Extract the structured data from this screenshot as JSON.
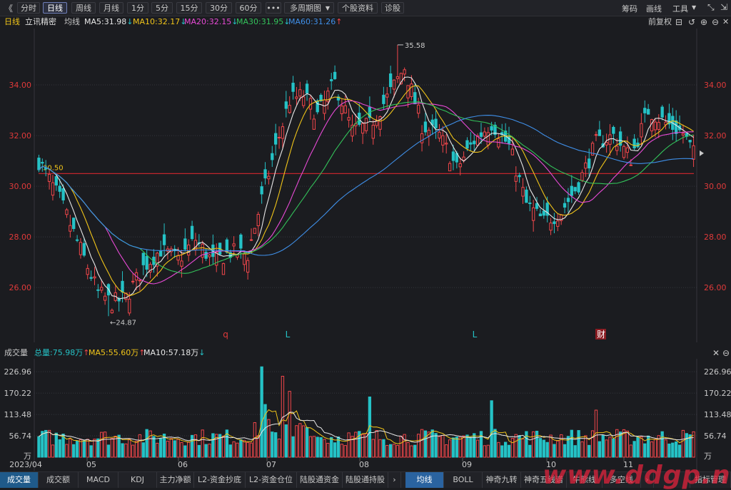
{
  "toolbar": {
    "collapse": "《",
    "periods": [
      "分时",
      "日线",
      "周线",
      "月线",
      "1分",
      "5分",
      "15分",
      "30分",
      "60分"
    ],
    "active_period": "日线",
    "more": "•••",
    "multi_period": "多周期图",
    "stock_info": "个股资料",
    "diagnose": "诊股",
    "right": [
      "筹码",
      "画线",
      "工具"
    ]
  },
  "price_header": {
    "period": "日线",
    "name": "立讯精密",
    "ma_label": "均线",
    "ma": [
      {
        "label": "MA5:31.98",
        "dir": "down",
        "color": "#e8e8e8"
      },
      {
        "label": "MA10:32.17",
        "dir": "down",
        "color": "#f0c419"
      },
      {
        "label": "MA20:32.15",
        "dir": "down",
        "color": "#e84ad6"
      },
      {
        "label": "MA30:31.95",
        "dir": "down",
        "color": "#33c25a"
      },
      {
        "label": "MA60:31.26",
        "dir": "up",
        "color": "#3f8fe8"
      }
    ],
    "adjust": "前复权"
  },
  "volume_header": {
    "title": "成交量",
    "total": "总量:75.98万",
    "ma5": "MA5:55.60万",
    "ma10": "MA10:57.18万"
  },
  "colors": {
    "up": "#f0464a",
    "down": "#25c2c6",
    "bg": "#1b1c20",
    "grid": "#34353c",
    "axis_text": "#e03a3a",
    "ma5": "#e8e8e8",
    "ma10": "#f0c419",
    "ma20": "#e84ad6",
    "ma30": "#33c25a",
    "ma60": "#3f8fe8"
  },
  "chart_data": [
    {
      "type": "candlestick",
      "y_ticks": [
        "34.00",
        "32.00",
        "30.00",
        "28.00",
        "26.00"
      ],
      "ylim": [
        24.4,
        36.0
      ],
      "high_label": "35.58",
      "low_label": "24.87",
      "ref_line_label": "30.50",
      "ref_line_value": 30.5,
      "markers": [
        "q",
        "L",
        "L",
        "财"
      ]
    },
    {
      "type": "bar",
      "y_ticks": [
        "226.96",
        "170.22",
        "113.48",
        "56.74",
        "万"
      ],
      "ylim": [
        0,
        250
      ],
      "x_labels": [
        "2023/04",
        "05",
        "06",
        "07",
        "08",
        "09",
        "10",
        "11"
      ]
    }
  ],
  "bottom_tabs": [
    "成交量",
    "成交额",
    "MACD",
    "KDJ",
    "主力净额",
    "L2-资金抄底",
    "L2-资金仓位",
    "陆股通资金",
    "陆股通持股",
    "均线",
    "BOLL",
    "神奇九转",
    "神奇五线谱",
    "牛熊线",
    "多空线",
    "指标管理"
  ],
  "watermark": "www.ddgp.net"
}
